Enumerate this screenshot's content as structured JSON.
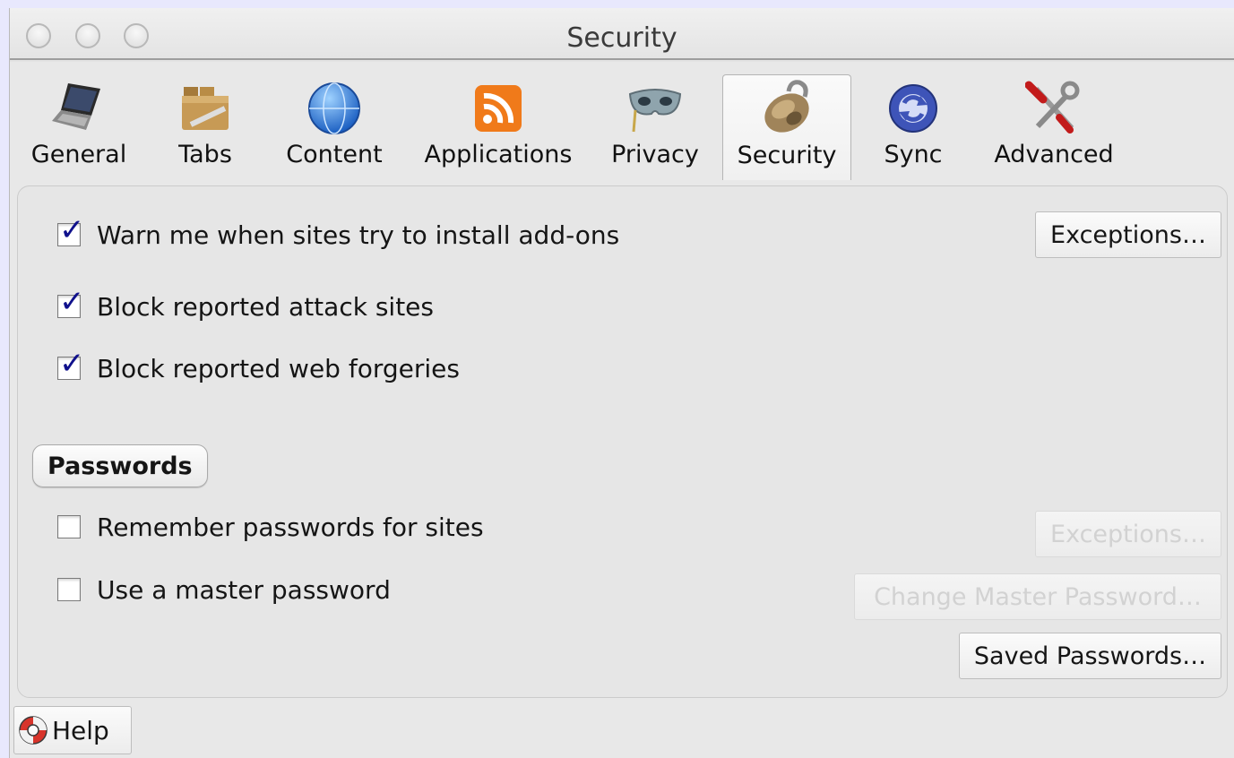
{
  "window": {
    "title": "Security"
  },
  "toolbar": {
    "tabs": [
      {
        "label": "General",
        "icon": "laptop-icon"
      },
      {
        "label": "Tabs",
        "icon": "folder-tabs-icon"
      },
      {
        "label": "Content",
        "icon": "globe-icon"
      },
      {
        "label": "Applications",
        "icon": "rss-feed-icon"
      },
      {
        "label": "Privacy",
        "icon": "mask-icon"
      },
      {
        "label": "Security",
        "icon": "padlock-icon",
        "selected": true
      },
      {
        "label": "Sync",
        "icon": "sync-arrows-icon"
      },
      {
        "label": "Advanced",
        "icon": "tools-icon"
      }
    ]
  },
  "security": {
    "addons": {
      "label": "Warn me when sites try to install add-ons",
      "checked": true
    },
    "addons_exceptions": "Exceptions…",
    "attack": {
      "label": "Block reported attack sites",
      "checked": true
    },
    "forgeries": {
      "label": "Block reported web forgeries",
      "checked": true
    }
  },
  "passwords": {
    "group_label": "Passwords",
    "remember": {
      "label": "Remember passwords for sites",
      "checked": false
    },
    "remember_exceptions": "Exceptions…",
    "master": {
      "label": "Use a master password",
      "checked": false
    },
    "change_master": "Change Master Password…",
    "saved_passwords": "Saved Passwords…"
  },
  "help": {
    "label": "Help",
    "icon": "lifebuoy-icon"
  },
  "colors": {
    "checkmark": "#10118c",
    "background": "#e8e8fd",
    "window": "#e8e8e8"
  }
}
